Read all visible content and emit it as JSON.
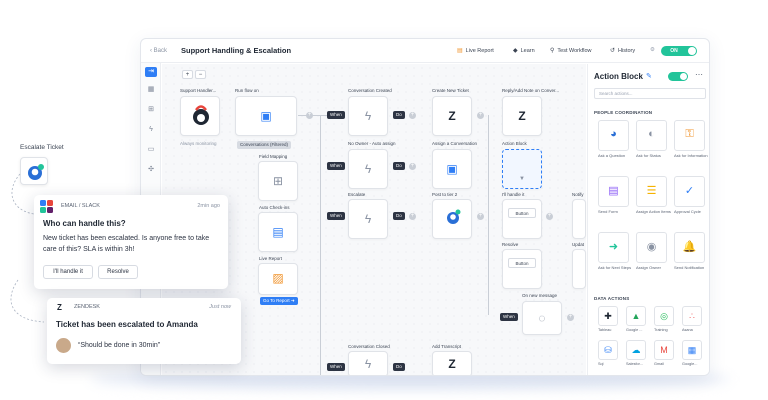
{
  "header": {
    "back": "Back",
    "title": "Support Handling & Escalation",
    "live_report": "Live Report",
    "learn": "Learn",
    "test_workflow": "Test Workflow",
    "history": "History",
    "toggle": "ON"
  },
  "canvas": {
    "zoom_in": "+",
    "zoom_out": "−",
    "support_handler": "Support Handler...",
    "always_monitoring": "Always monitoring",
    "run_flow_on": "Run flow on",
    "conversations_filtered": "Conversations (Filtered)",
    "field_mapping": "Field Mapping",
    "auto_check_ins": "Auto Check-ins",
    "live_report": "Live Report",
    "go_to_report": "Go To Report ➜",
    "when": "When",
    "do": "Do",
    "conversation_created": "Conversation Created",
    "no_owner": "No Owner - Auto assign",
    "escalate": "Escalate",
    "conversation_closed": "Conversation Closed",
    "create_new_ticket": "Create New Ticket",
    "assign_a_conversation": "Assign a Conversation",
    "post_to_tier2": "Post to tier 2",
    "add_transcript": "Add Transcript",
    "reply_add_note": "Reply/Add Note on Conver...",
    "action_block": "Action Block",
    "ill_handle_it": "I'll handle it",
    "resolve": "Resolve",
    "on_new_message": "On new message",
    "button": "Button",
    "notify": "Notify",
    "update": "Updat"
  },
  "panel": {
    "title": "Action Block",
    "search_placeholder": "Search actions...",
    "people_section": "PEOPLE COORDINATION",
    "people_actions": [
      {
        "label": "Ask a Question",
        "icon": "question-person-icon",
        "color": "#2a6fd6"
      },
      {
        "label": "Ask for Status",
        "icon": "status-icon",
        "color": "#8a93a3"
      },
      {
        "label": "Ask for Information",
        "icon": "info-key-icon",
        "color": "#f0932b"
      },
      {
        "label": "Send Form",
        "icon": "form-icon",
        "color": "#8b5cf6"
      },
      {
        "label": "Assign Action Items",
        "icon": "list-icon",
        "color": "#f5b301"
      },
      {
        "label": "Approval Cycle",
        "icon": "approval-icon",
        "color": "#2f7ef5"
      },
      {
        "label": "Ask for Next Steps",
        "icon": "next-steps-icon",
        "color": "#22c49a"
      },
      {
        "label": "Assign Owner",
        "icon": "owner-icon",
        "color": "#8a93a3"
      },
      {
        "label": "Send Notification",
        "icon": "bell-icon",
        "color": "#e8453c"
      }
    ],
    "data_section": "DATA ACTIONS",
    "data_actions": [
      {
        "label": "Tableau",
        "icon": "tableau-icon",
        "color": "#1f2733"
      },
      {
        "label": "Google ...",
        "icon": "google-drive-icon",
        "color": "#22a55a"
      },
      {
        "label": "Training",
        "icon": "spotify-icon",
        "color": "#1db954"
      },
      {
        "label": "Asana",
        "icon": "asana-icon",
        "color": "#f06a6a"
      },
      {
        "label": "Sql",
        "icon": "sql-icon",
        "color": "#2f7ef5"
      },
      {
        "label": "Salesfor...",
        "icon": "salesforce-icon",
        "color": "#00a1e0"
      },
      {
        "label": "Gmail",
        "icon": "gmail-icon",
        "color": "#e8453c"
      },
      {
        "label": "Google...",
        "icon": "calendar-icon",
        "color": "#2f7ef5"
      }
    ]
  },
  "left": {
    "escalate_ticket": "Escalate Ticket"
  },
  "slack_card": {
    "source": "EMAIL / SLACK",
    "time": "2min ago",
    "title": "Who can handle this?",
    "body": "New ticket has been escalated. Is anyone free to take care of this? SLA is within 3h!",
    "btn_handle": "I'll handle it",
    "btn_resolve": "Resolve"
  },
  "zendesk_card": {
    "source": "ZENDESK",
    "time": "Just now",
    "title": "Ticket has been escalated to Amanda",
    "quote": "“Should be done in 30min”"
  },
  "colors": {
    "accent": "#2f7ef5",
    "toggle_green": "#22c49a",
    "dark_pill": "#2d3443"
  }
}
